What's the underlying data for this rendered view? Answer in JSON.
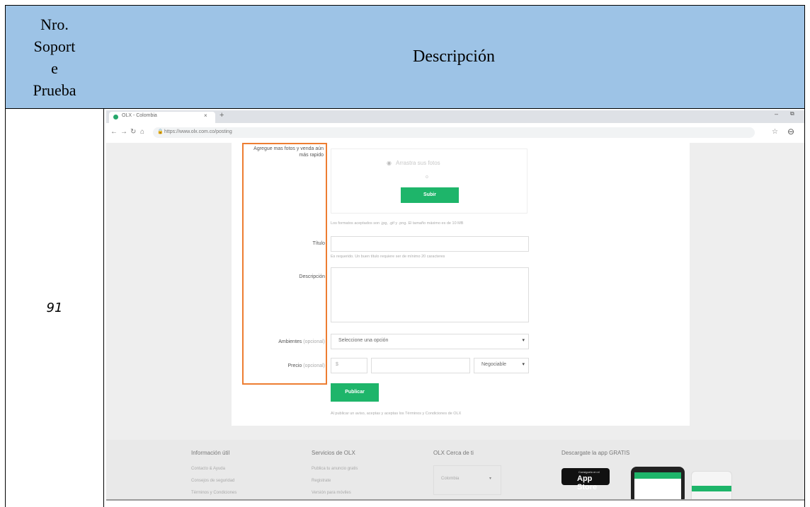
{
  "table": {
    "header_number": "Nro. Soport e Prueba",
    "header_number_lines": [
      "Nro.",
      "Soport",
      "e",
      "Prueba"
    ],
    "header_description": "Descripción",
    "row_number": "91"
  },
  "colors": {
    "header_bg": "#9dc3e6",
    "highlight_border": "#ed7d31",
    "olx_green": "#1eb56a"
  },
  "browser": {
    "tab_title": "OLX - Colombia",
    "tab_close": "×",
    "new_tab": "+",
    "minimize": "–",
    "restore": "⧉",
    "url": "https://www.olx.com.co/posting",
    "back": "←",
    "forward": "→",
    "reload": "↻",
    "home": "⌂",
    "lock": "🔒",
    "bookmark": "☆",
    "profile": "⊖"
  },
  "form": {
    "photos_label": "Agregue mas fotos y venda aún más rapido",
    "photo_placeholder": "Arrastra sus fotos",
    "photo_or": "o",
    "upload_button": "Subir",
    "photo_hint": "Los formatos aceptados son .jpg, .gif y .png. El tamaño máximo es de 10 MB",
    "title_label": "Título",
    "title_hint": "Es requerido. Un buen título requiere ser de mínimo 20 caracteres",
    "description_label": "Descripción",
    "ambientes_label": "Ambientes",
    "optional": "(opcional)",
    "ambientes_select": "Seleccione una opción",
    "precio_label": "Precio",
    "currency": "$",
    "negotiable": "Negociable",
    "publish_button": "Publicar",
    "terms_text": "Al publicar un aviso, aceptas y aceptas los Términos y Condiciones de OLX"
  },
  "footer": {
    "col1_title": "Información útil",
    "col1_links": [
      "Contacto & Ayuda",
      "Consejos de seguridad",
      "Términos y Condiciones"
    ],
    "col2_title": "Servicios de OLX",
    "col2_links": [
      "Publica tu anuncio gratis",
      "Registrate",
      "Versión para móviles"
    ],
    "col3_title": "OLX Cerca de ti",
    "col3_select": "Colombia",
    "col4_title": "Descargate la app GRATIS",
    "appstore_small": "Consiguelo en el",
    "appstore_big": "App Store"
  }
}
